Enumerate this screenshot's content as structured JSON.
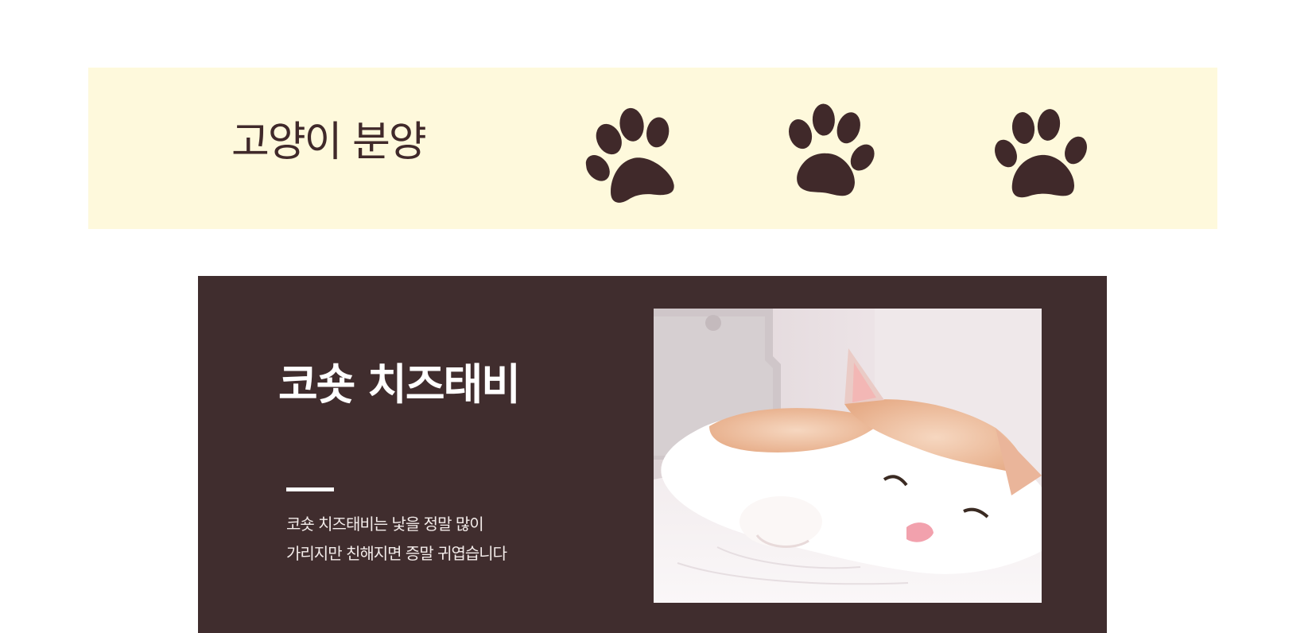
{
  "banner": {
    "title": "고양이 분양",
    "background_color": "#fef9dc",
    "text_color": "#40292a",
    "icons": [
      "paw-print-icon",
      "paw-print-icon",
      "paw-print-icon"
    ]
  },
  "card": {
    "title": "코숏 치즈태비",
    "description_lines": [
      "코숏 치즈태비는 낯을 정말 많이",
      "가리지만 친해지면 증말 귀엽습니다"
    ],
    "background_color": "#402d2e",
    "photo_alt": "cat-photo"
  }
}
